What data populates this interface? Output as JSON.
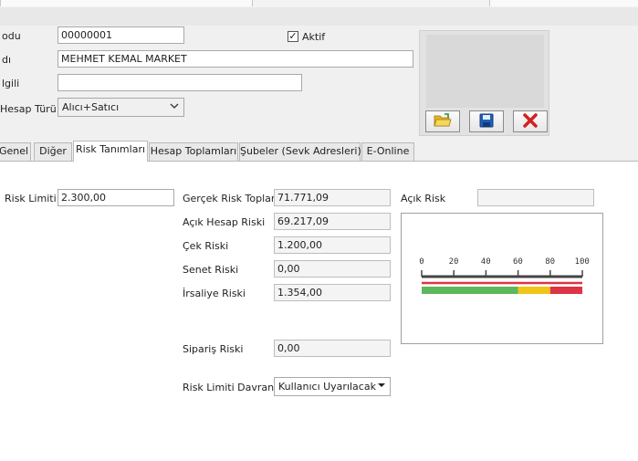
{
  "header": {
    "fields": {
      "kodu_label": "odu",
      "kodu_value": "00000001",
      "adi_label": "dı",
      "adi_value": "MEHMET KEMAL MARKET",
      "ilgili_label": "lgili",
      "ilgili_value": "",
      "hesap_turu_label": "Hesap Türü",
      "hesap_turu_value": "Alıcı+Satıcı",
      "aktif_label": "Aktif",
      "aktif_checked": "✓"
    },
    "image_buttons": {
      "open_icon": "folder-open-icon",
      "save_icon": "save-icon",
      "delete_icon": "delete-icon"
    }
  },
  "tabs": [
    {
      "label": "Genel"
    },
    {
      "label": "Diğer"
    },
    {
      "label": "Risk Tanımları"
    },
    {
      "label": "Hesap Toplamları"
    },
    {
      "label": "Şubeler (Sevk Adresleri)"
    },
    {
      "label": "E-Online"
    }
  ],
  "risk": {
    "risk_limiti_label": "Risk Limiti",
    "risk_limiti_value": "2.300,00",
    "gercek_risk_label": "Gerçek Risk Toplamı",
    "gercek_risk_value": "71.771,09",
    "acik_hesap_label": "Açık Hesap Riski",
    "acik_hesap_value": "69.217,09",
    "cek_label": "Çek Riski",
    "cek_value": "1.200,00",
    "senet_label": "Senet Riski",
    "senet_value": "0,00",
    "irsaliye_label": "İrsaliye Riski",
    "irsaliye_value": "1.354,00",
    "siparis_label": "Sipariş Riski",
    "siparis_value": "0,00",
    "davranim_label": "Risk Limiti Davranımı",
    "davranim_value": "Kullanıcı Uyarılacak",
    "acik_risk_label": "Açık Risk",
    "acik_risk_value": ""
  },
  "gauge": {
    "ticks": [
      "0",
      "20",
      "40",
      "60",
      "80",
      "100"
    ],
    "ranges": [
      {
        "from": 0,
        "to": 60,
        "color": "#5cb85c"
      },
      {
        "from": 60,
        "to": 80,
        "color": "#f0c419"
      },
      {
        "from": 80,
        "to": 100,
        "color": "#dc3545"
      }
    ],
    "indicator_color": "#dc3545"
  }
}
